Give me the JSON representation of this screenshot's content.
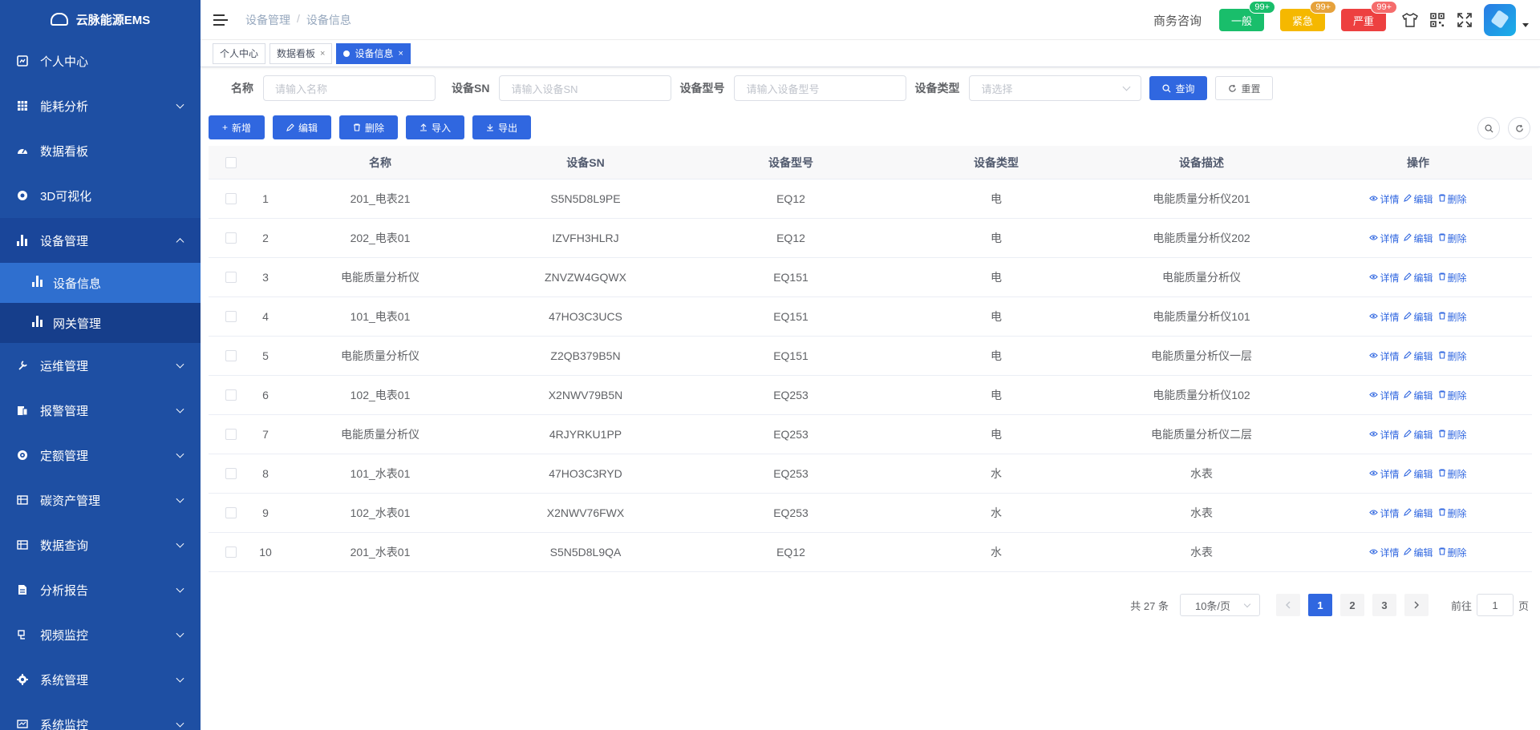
{
  "app": {
    "name": "云脉能源EMS"
  },
  "sidebar": {
    "items": [
      {
        "label": "个人中心",
        "icon": "dashboard-icon"
      },
      {
        "label": "能耗分析",
        "icon": "table-icon"
      },
      {
        "label": "数据看板",
        "icon": "gauge-icon"
      },
      {
        "label": "3D可视化",
        "icon": "cube-icon"
      },
      {
        "label": "设备管理",
        "icon": "bar-chart-icon"
      },
      {
        "label": "运维管理",
        "icon": "tool-icon"
      },
      {
        "label": "报警管理",
        "icon": "alarm-icon"
      },
      {
        "label": "定额管理",
        "icon": "target-icon"
      },
      {
        "label": "碳资产管理",
        "icon": "grid-icon"
      },
      {
        "label": "数据查询",
        "icon": "grid-icon"
      },
      {
        "label": "分析报告",
        "icon": "report-icon"
      },
      {
        "label": "视频监控",
        "icon": "video-icon"
      },
      {
        "label": "系统管理",
        "icon": "gear-icon"
      },
      {
        "label": "系统监控",
        "icon": "monitor-icon"
      }
    ],
    "submenu": [
      {
        "label": "设备信息"
      },
      {
        "label": "网关管理"
      }
    ]
  },
  "header": {
    "breadcrumb": [
      "设备管理",
      "设备信息"
    ],
    "business": "商务咨询",
    "alarms": [
      {
        "label": "一般",
        "badge": "99+",
        "color": "#19be6b",
        "badge_color": "#19be6b"
      },
      {
        "label": "紧急",
        "badge": "99+",
        "color": "#f5b800",
        "badge_color": "#e6a23c"
      },
      {
        "label": "严重",
        "badge": "99+",
        "color": "#ed4040",
        "badge_color": "#f56c6c"
      }
    ]
  },
  "tags": [
    {
      "label": "个人中心"
    },
    {
      "label": "数据看板"
    },
    {
      "label": "设备信息"
    }
  ],
  "filter": {
    "name_label": "名称",
    "name_placeholder": "请输入名称",
    "sn_label": "设备SN",
    "sn_placeholder": "请输入设备SN",
    "model_label": "设备型号",
    "model_placeholder": "请输入设备型号",
    "type_label": "设备类型",
    "type_placeholder": "请选择",
    "search": "查询",
    "reset": "重置"
  },
  "toolbar": {
    "add": "新增",
    "edit": "编辑",
    "delete": "删除",
    "import": "导入",
    "export": "导出"
  },
  "table": {
    "columns": [
      "名称",
      "设备SN",
      "设备型号",
      "设备类型",
      "设备描述",
      "操作"
    ],
    "actions": {
      "detail": "详情",
      "edit": "编辑",
      "delete": "删除"
    },
    "rows": [
      {
        "idx": "1",
        "name": "201_电表21",
        "sn": "S5N5D8L9PE",
        "model": "EQ12",
        "type": "电",
        "desc": "电能质量分析仪201"
      },
      {
        "idx": "2",
        "name": "202_电表01",
        "sn": "IZVFH3HLRJ",
        "model": "EQ12",
        "type": "电",
        "desc": "电能质量分析仪202"
      },
      {
        "idx": "3",
        "name": "电能质量分析仪",
        "sn": "ZNVZW4GQWX",
        "model": "EQ151",
        "type": "电",
        "desc": "电能质量分析仪"
      },
      {
        "idx": "4",
        "name": "101_电表01",
        "sn": "47HO3C3UCS",
        "model": "EQ151",
        "type": "电",
        "desc": "电能质量分析仪101"
      },
      {
        "idx": "5",
        "name": "电能质量分析仪",
        "sn": "Z2QB379B5N",
        "model": "EQ151",
        "type": "电",
        "desc": "电能质量分析仪一层"
      },
      {
        "idx": "6",
        "name": "102_电表01",
        "sn": "X2NWV79B5N",
        "model": "EQ253",
        "type": "电",
        "desc": "电能质量分析仪102"
      },
      {
        "idx": "7",
        "name": "电能质量分析仪",
        "sn": "4RJYRKU1PP",
        "model": "EQ253",
        "type": "电",
        "desc": "电能质量分析仪二层"
      },
      {
        "idx": "8",
        "name": "101_水表01",
        "sn": "47HO3C3RYD",
        "model": "EQ253",
        "type": "水",
        "desc": "水表"
      },
      {
        "idx": "9",
        "name": "102_水表01",
        "sn": "X2NWV76FWX",
        "model": "EQ253",
        "type": "水",
        "desc": "水表"
      },
      {
        "idx": "10",
        "name": "201_水表01",
        "sn": "S5N5D8L9QA",
        "model": "EQ12",
        "type": "水",
        "desc": "水表"
      }
    ]
  },
  "pagination": {
    "total": "共 27 条",
    "page_size": "10条/页",
    "pages": [
      "1",
      "2",
      "3"
    ],
    "goto_label": "前往",
    "goto_value": "1",
    "page_suffix": "页"
  }
}
